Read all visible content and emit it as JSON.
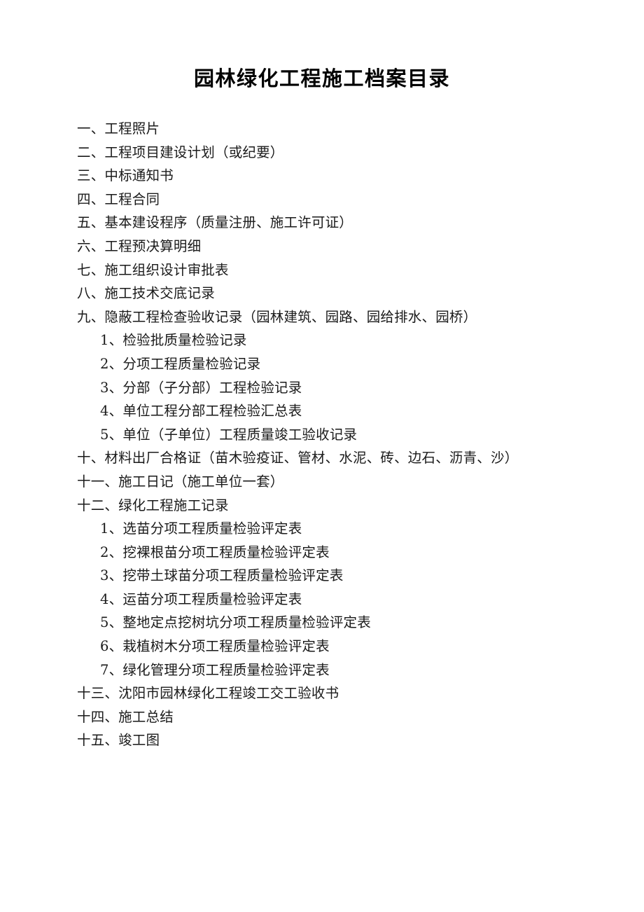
{
  "document": {
    "title": "园林绿化工程施工档案目录",
    "background_color": "#ffffff",
    "text_color": "#1a1a1a"
  },
  "toc": {
    "entries": [
      {
        "marker": "一、",
        "label": "工程照片",
        "level": 1
      },
      {
        "marker": "二、",
        "label": "工程项目建设计划（或纪要）",
        "level": 1
      },
      {
        "marker": "三、",
        "label": "中标通知书",
        "level": 1
      },
      {
        "marker": "四、",
        "label": "工程合同",
        "level": 1
      },
      {
        "marker": "五、",
        "label": "基本建设程序（质量注册、施工许可证）",
        "level": 1
      },
      {
        "marker": "六、",
        "label": "工程预决算明细",
        "level": 1
      },
      {
        "marker": "七、",
        "label": "施工组织设计审批表",
        "level": 1
      },
      {
        "marker": "八、",
        "label": "施工技术交底记录",
        "level": 1
      },
      {
        "marker": "九、",
        "label": "隐蔽工程检查验收记录（园林建筑、园路、园给排水、园桥）",
        "level": 1
      },
      {
        "marker": "1、",
        "label": "检验批质量检验记录",
        "level": 2
      },
      {
        "marker": "2、",
        "label": "分项工程质量检验记录",
        "level": 2
      },
      {
        "marker": "3、",
        "label": "分部（子分部）工程检验记录",
        "level": 2
      },
      {
        "marker": "4、",
        "label": "单位工程分部工程检验汇总表",
        "level": 2
      },
      {
        "marker": "5、",
        "label": "单位（子单位）工程质量竣工验收记录",
        "level": 2
      },
      {
        "marker": "十、",
        "label": "材料出厂合格证（苗木验疫证、管材、水泥、砖、边石、沥青、沙）",
        "level": 1
      },
      {
        "marker": "十一、",
        "label": "施工日记（施工单位一套）",
        "level": 1
      },
      {
        "marker": "十二、",
        "label": "绿化工程施工记录",
        "level": 1
      },
      {
        "marker": "1、",
        "label": "选苗分项工程质量检验评定表",
        "level": 2
      },
      {
        "marker": "2、",
        "label": "挖裸根苗分项工程质量检验评定表",
        "level": 2
      },
      {
        "marker": "3、",
        "label": "挖带土球苗分项工程质量检验评定表",
        "level": 2
      },
      {
        "marker": "4、",
        "label": "运苗分项工程质量检验评定表",
        "level": 2
      },
      {
        "marker": "5、",
        "label": "整地定点挖树坑分项工程质量检验评定表",
        "level": 2
      },
      {
        "marker": "6、",
        "label": "栽植树木分项工程质量检验评定表",
        "level": 2
      },
      {
        "marker": "7、",
        "label": "绿化管理分项工程质量检验评定表",
        "level": 2
      },
      {
        "marker": "十三、",
        "label": "沈阳市园林绿化工程竣工交工验收书",
        "level": 1
      },
      {
        "marker": "十四、",
        "label": "施工总结",
        "level": 1
      },
      {
        "marker": "十五、",
        "label": "竣工图",
        "level": 1
      }
    ]
  }
}
